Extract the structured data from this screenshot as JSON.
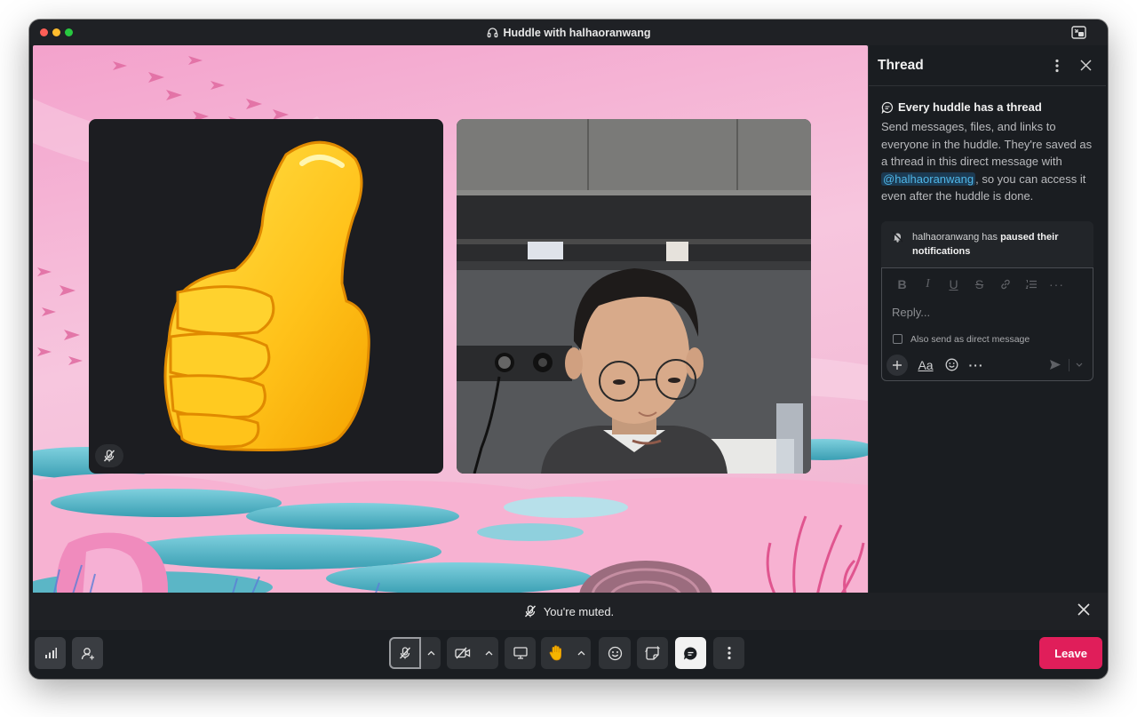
{
  "window": {
    "title": "Huddle with halhaoranwang",
    "title_icon": "headphones-icon"
  },
  "thread": {
    "title": "Thread",
    "intro_title": "Every huddle has a thread",
    "intro_body_before": "Send messages, files, and links to everyone in the huddle. They're saved as a thread in this direct message with ",
    "mention": "@halhaoranwang",
    "intro_body_after": ", so you can access it even after the huddle is done.",
    "notice_user": "halhaoranwang has ",
    "notice_bold": "paused their notifications",
    "reply_placeholder": "Reply...",
    "also_send_label": "Also send as direct message",
    "aa_label": "Aa"
  },
  "notification": {
    "muted_text": "You're muted."
  },
  "controls": {
    "leave_label": "Leave"
  },
  "colors": {
    "leave": "#e01e5a",
    "mention": "#4fb7e8",
    "background_pink": "#f5a6cf"
  }
}
